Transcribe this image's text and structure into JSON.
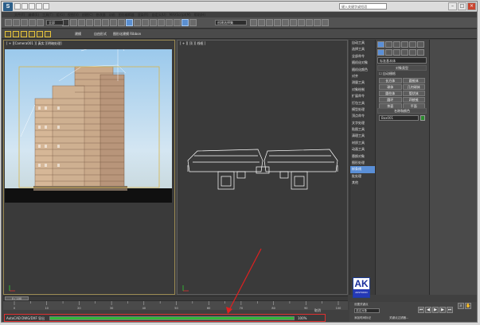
{
  "app": {
    "logo": "S",
    "search_placeholder": "键入关键字或短语"
  },
  "menu": [
    "文件(F)",
    "编辑(E)",
    "工具(T)",
    "组(G)",
    "视图(V)",
    "创建(C)",
    "修改器",
    "动画",
    "图形编辑器",
    "渲染(R)",
    "自定义(U)",
    "MAXScript(M)",
    "帮助(H)"
  ],
  "toolbar": {
    "selection_filter": "全部",
    "named_selection": "创建选择集",
    "secondary_labels": [
      "建模",
      "自由形式",
      "选择",
      "对象绘制",
      "填充"
    ],
    "secondary_text": "图形化建模 Ribbon"
  },
  "viewports": {
    "left_label": "[ + ][Camera001 ][ 真实 ][明暗处理]",
    "right_label": "[ + ][ 顶 ][ 线框 ]"
  },
  "cmd_list": [
    "自动工具",
    "选择工具",
    "全部命令",
    "随机化对象",
    "随机化颜色",
    "对齐",
    "测量工具",
    "对象绘制",
    "扩展命令",
    "打包工具",
    "模型处理",
    "顶点命令",
    "文字处理",
    "贴图工具",
    "清理工具",
    "材质工具",
    "动画工具",
    "替换对象",
    "图形处理",
    "样条线",
    "批处理",
    "其他"
  ],
  "cmd_list_selected": 19,
  "command_panel": {
    "dropdown": "标准基本体",
    "rollout_type": "对象类型",
    "autogrid": "自动栅格",
    "buttons": [
      "长方体",
      "圆锥体",
      "球体",
      "几何球体",
      "圆柱体",
      "管状体",
      "圆环",
      "四棱锥",
      "茶壶",
      "平面"
    ],
    "rollout_name": "名称和颜色",
    "name_value": "Box001",
    "swatch_color": "#2b8a2e"
  },
  "logo": {
    "big": "AK",
    "small": "AKSTUDIO"
  },
  "timeline": {
    "frame_label": "0 / 100",
    "ticks": [
      "0",
      "10",
      "20",
      "30",
      "40",
      "50",
      "60",
      "70",
      "80",
      "90",
      "100"
    ]
  },
  "status": {
    "label": "AutoCAD DWG/DXF 导出",
    "progress_percent": 100,
    "progress_text": "100%"
  },
  "bottom_right": {
    "select_value": "选定对象",
    "add_key": "添加时间标记",
    "set_key": "设置关键点",
    "filter": "关键点过滤器...",
    "status_hint": "取消"
  },
  "colors": {
    "accent": "#5a8fd7",
    "progress": "#33b83a",
    "highlight_border": "#e03030"
  }
}
